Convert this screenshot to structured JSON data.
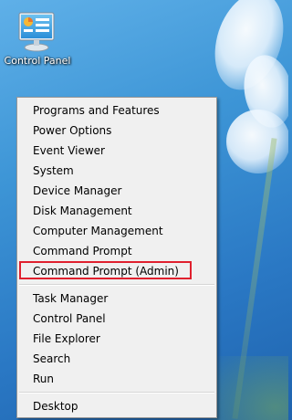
{
  "desktop": {
    "icon": {
      "label": "Control Panel",
      "icon_name": "control-panel-icon"
    }
  },
  "menu": {
    "groups": [
      {
        "items": [
          {
            "label": "Programs and Features"
          },
          {
            "label": "Power Options"
          },
          {
            "label": "Event Viewer"
          },
          {
            "label": "System"
          },
          {
            "label": "Device Manager"
          },
          {
            "label": "Disk Management"
          },
          {
            "label": "Computer Management"
          },
          {
            "label": "Command Prompt"
          },
          {
            "label": "Command Prompt (Admin)",
            "highlighted": true
          }
        ]
      },
      {
        "items": [
          {
            "label": "Task Manager"
          },
          {
            "label": "Control Panel"
          },
          {
            "label": "File Explorer"
          },
          {
            "label": "Search"
          },
          {
            "label": "Run"
          }
        ]
      },
      {
        "items": [
          {
            "label": "Desktop"
          }
        ]
      }
    ],
    "highlight_color": "#e0202e"
  }
}
